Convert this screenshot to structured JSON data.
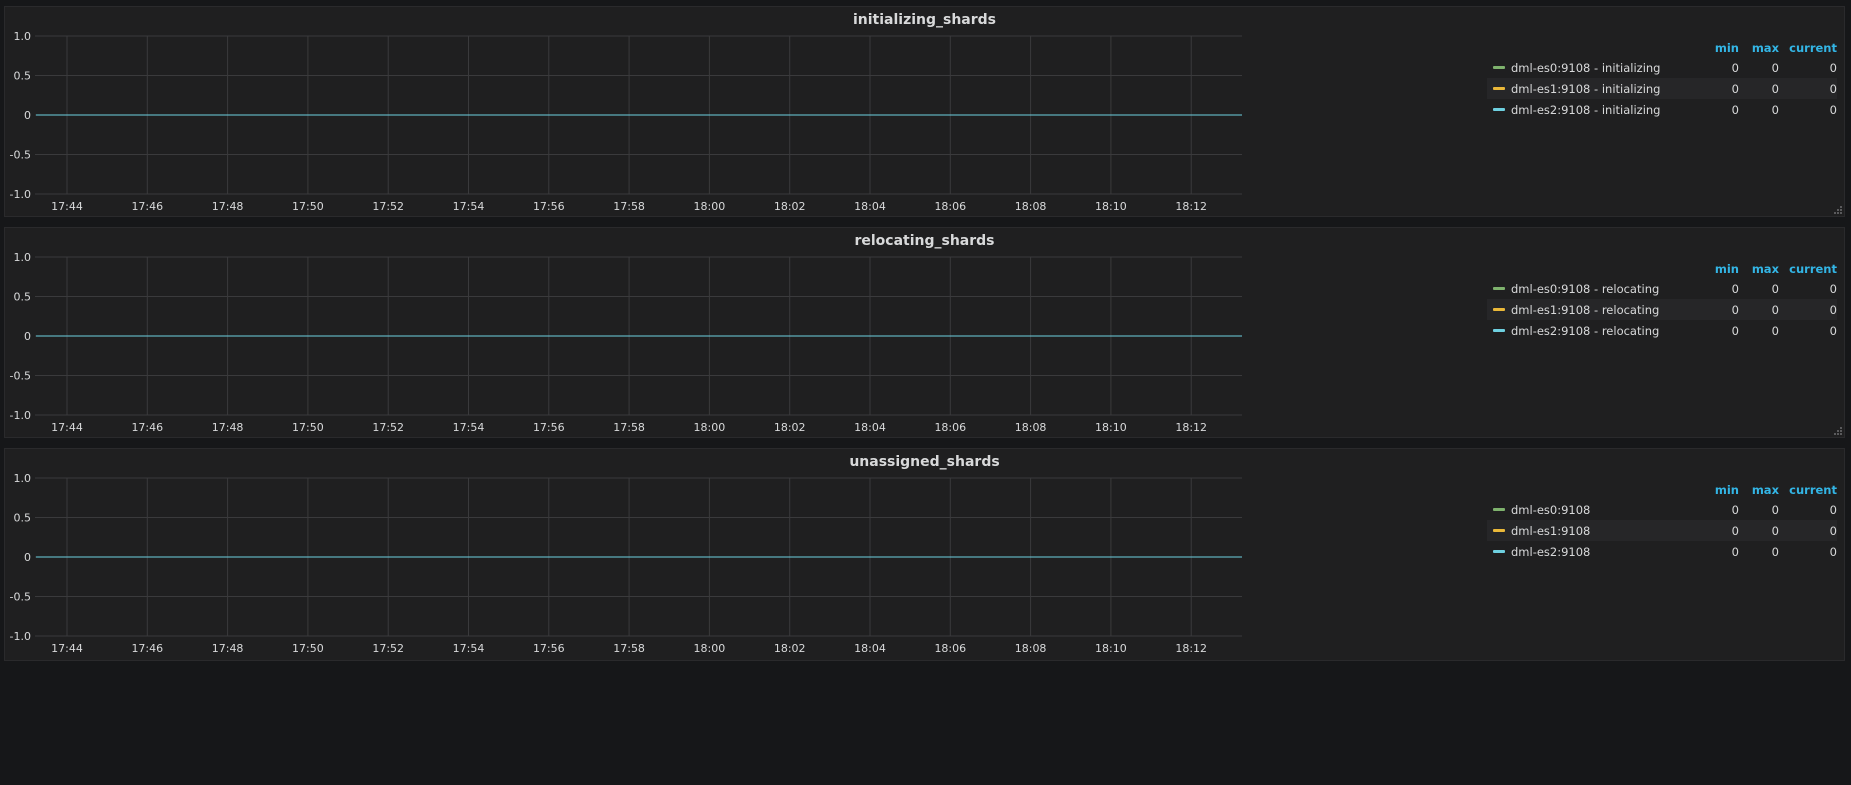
{
  "colors": {
    "series": [
      "#7eb26d",
      "#eab839",
      "#6ed0e0"
    ],
    "accent": "#33b5e5",
    "background": "#161719",
    "panel": "#1f1f20",
    "grid": "#3a3a3c"
  },
  "legend_columns": {
    "min": "min",
    "max": "max",
    "current": "current"
  },
  "panels": [
    {
      "title": "initializing_shards",
      "series": [
        {
          "name": "dml-es0:9108 - initializing",
          "min": "0",
          "max": "0",
          "current": "0"
        },
        {
          "name": "dml-es1:9108 - initializing",
          "min": "0",
          "max": "0",
          "current": "0"
        },
        {
          "name": "dml-es2:9108 - initializing",
          "min": "0",
          "max": "0",
          "current": "0"
        }
      ]
    },
    {
      "title": "relocating_shards",
      "series": [
        {
          "name": "dml-es0:9108 - relocating",
          "min": "0",
          "max": "0",
          "current": "0"
        },
        {
          "name": "dml-es1:9108 - relocating",
          "min": "0",
          "max": "0",
          "current": "0"
        },
        {
          "name": "dml-es2:9108 - relocating",
          "min": "0",
          "max": "0",
          "current": "0"
        }
      ]
    },
    {
      "title": "unassigned_shards",
      "series": [
        {
          "name": "dml-es0:9108",
          "min": "0",
          "max": "0",
          "current": "0"
        },
        {
          "name": "dml-es1:9108",
          "min": "0",
          "max": "0",
          "current": "0"
        },
        {
          "name": "dml-es2:9108",
          "min": "0",
          "max": "0",
          "current": "0"
        }
      ]
    }
  ],
  "chart_data": [
    {
      "type": "line",
      "title": "initializing_shards",
      "x": [
        "17:44",
        "17:46",
        "17:48",
        "17:50",
        "17:52",
        "17:54",
        "17:56",
        "17:58",
        "18:00",
        "18:02",
        "18:04",
        "18:06",
        "18:08",
        "18:10",
        "18:12"
      ],
      "xticks": [
        "17:44",
        "17:46",
        "17:48",
        "17:50",
        "17:52",
        "17:54",
        "17:56",
        "17:58",
        "18:00",
        "18:02",
        "18:04",
        "18:06",
        "18:08",
        "18:10",
        "18:12"
      ],
      "yticks": [
        "1.0",
        "0.5",
        "0",
        "-0.5",
        "-1.0"
      ],
      "ylim": [
        -1.0,
        1.0
      ],
      "grid": true,
      "legend": "right",
      "series": [
        {
          "name": "dml-es0:9108 - initializing",
          "values": [
            0,
            0,
            0,
            0,
            0,
            0,
            0,
            0,
            0,
            0,
            0,
            0,
            0,
            0,
            0
          ]
        },
        {
          "name": "dml-es1:9108 - initializing",
          "values": [
            0,
            0,
            0,
            0,
            0,
            0,
            0,
            0,
            0,
            0,
            0,
            0,
            0,
            0,
            0
          ]
        },
        {
          "name": "dml-es2:9108 - initializing",
          "values": [
            0,
            0,
            0,
            0,
            0,
            0,
            0,
            0,
            0,
            0,
            0,
            0,
            0,
            0,
            0
          ]
        }
      ]
    },
    {
      "type": "line",
      "title": "relocating_shards",
      "x": [
        "17:44",
        "17:46",
        "17:48",
        "17:50",
        "17:52",
        "17:54",
        "17:56",
        "17:58",
        "18:00",
        "18:02",
        "18:04",
        "18:06",
        "18:08",
        "18:10",
        "18:12"
      ],
      "xticks": [
        "17:44",
        "17:46",
        "17:48",
        "17:50",
        "17:52",
        "17:54",
        "17:56",
        "17:58",
        "18:00",
        "18:02",
        "18:04",
        "18:06",
        "18:08",
        "18:10",
        "18:12"
      ],
      "yticks": [
        "1.0",
        "0.5",
        "0",
        "-0.5",
        "-1.0"
      ],
      "ylim": [
        -1.0,
        1.0
      ],
      "grid": true,
      "legend": "right",
      "series": [
        {
          "name": "dml-es0:9108 - relocating",
          "values": [
            0,
            0,
            0,
            0,
            0,
            0,
            0,
            0,
            0,
            0,
            0,
            0,
            0,
            0,
            0
          ]
        },
        {
          "name": "dml-es1:9108 - relocating",
          "values": [
            0,
            0,
            0,
            0,
            0,
            0,
            0,
            0,
            0,
            0,
            0,
            0,
            0,
            0,
            0
          ]
        },
        {
          "name": "dml-es2:9108 - relocating",
          "values": [
            0,
            0,
            0,
            0,
            0,
            0,
            0,
            0,
            0,
            0,
            0,
            0,
            0,
            0,
            0
          ]
        }
      ]
    },
    {
      "type": "line",
      "title": "unassigned_shards",
      "x": [
        "17:44",
        "17:46",
        "17:48",
        "17:50",
        "17:52",
        "17:54",
        "17:56",
        "17:58",
        "18:00",
        "18:02",
        "18:04",
        "18:06",
        "18:08",
        "18:10",
        "18:12"
      ],
      "xticks": [
        "17:44",
        "17:46",
        "17:48",
        "17:50",
        "17:52",
        "17:54",
        "17:56",
        "17:58",
        "18:00",
        "18:02",
        "18:04",
        "18:06",
        "18:08",
        "18:10",
        "18:12"
      ],
      "yticks": [
        "1.0",
        "0.5",
        "0",
        "-0.5",
        "-1.0"
      ],
      "ylim": [
        -1.0,
        1.0
      ],
      "grid": true,
      "legend": "right",
      "series": [
        {
          "name": "dml-es0:9108",
          "values": [
            0,
            0,
            0,
            0,
            0,
            0,
            0,
            0,
            0,
            0,
            0,
            0,
            0,
            0,
            0
          ]
        },
        {
          "name": "dml-es1:9108",
          "values": [
            0,
            0,
            0,
            0,
            0,
            0,
            0,
            0,
            0,
            0,
            0,
            0,
            0,
            0,
            0
          ]
        },
        {
          "name": "dml-es2:9108",
          "values": [
            0,
            0,
            0,
            0,
            0,
            0,
            0,
            0,
            0,
            0,
            0,
            0,
            0,
            0,
            0
          ]
        }
      ]
    }
  ]
}
